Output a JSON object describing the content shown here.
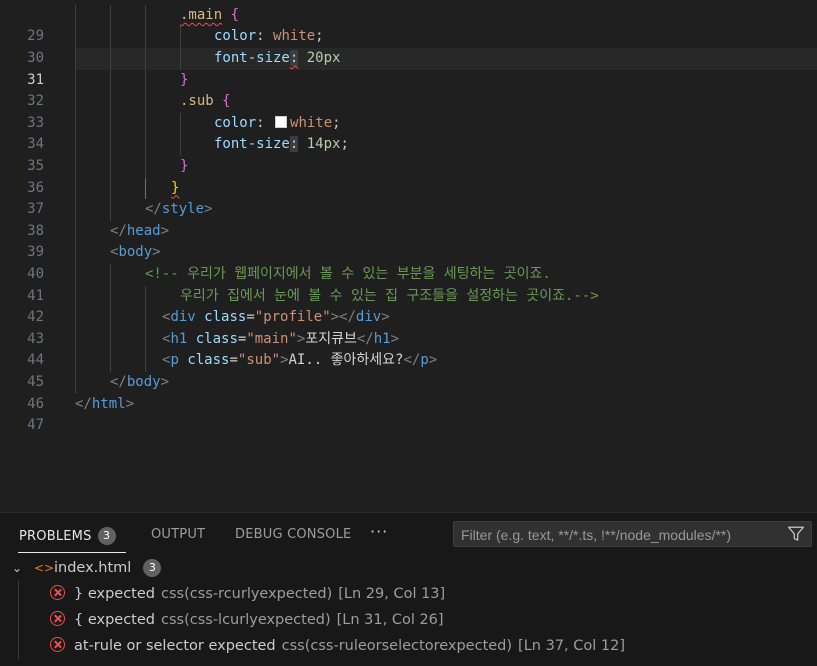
{
  "editor": {
    "current_line": 31,
    "lines": [
      {
        "n": "29"
      },
      {
        "n": "30"
      },
      {
        "n": "31"
      },
      {
        "n": "32"
      },
      {
        "n": "33"
      },
      {
        "n": "34"
      },
      {
        "n": "35"
      },
      {
        "n": "36"
      },
      {
        "n": "37"
      },
      {
        "n": "38"
      },
      {
        "n": "39"
      },
      {
        "n": "40"
      },
      {
        "n": "41"
      },
      {
        "n": "42"
      },
      {
        "n": "43"
      },
      {
        "n": "44"
      },
      {
        "n": "45"
      },
      {
        "n": "46"
      },
      {
        "n": "47"
      }
    ],
    "code": {
      "l29_sel": ".main",
      "l29_brace": "{",
      "l30_prop": "color",
      "l30_val": "white",
      "l31_prop": "font-size",
      "l31_val": "20px",
      "l32_brace": "}",
      "l33_sel": ".sub",
      "l33_brace": "{",
      "l34_prop": "color",
      "l34_val": "white",
      "l35_prop": "font-size",
      "l35_val": "14px",
      "l36_brace": "}",
      "l37_brace": "}",
      "l38_tag": "style",
      "l39_tag": "head",
      "l40_tag": "body",
      "l41_comment": "<!-- 우리가 웹페이지에서 볼 수 있는 부분을 세팅하는 곳이죠.",
      "l42_comment": "우리가 집에서 눈에 볼 수 있는 집 구조들을 설정하는 곳이죠.-->",
      "l43_tag": "div",
      "l43_attr": "class",
      "l43_str": "\"profile\"",
      "l44_tag": "h1",
      "l44_attr": "class",
      "l44_str": "\"main\"",
      "l44_text": "포지큐브",
      "l45_tag": "p",
      "l45_attr": "class",
      "l45_str": "\"sub\"",
      "l45_text": "AI.. 좋아하세요?",
      "l46_tag": "body",
      "l47_tag": "html"
    }
  },
  "panel": {
    "tabs": [
      {
        "label": "PROBLEMS",
        "badge": "3"
      },
      {
        "label": "OUTPUT"
      },
      {
        "label": "DEBUG CONSOLE"
      }
    ],
    "more": "···",
    "filter_placeholder": "Filter (e.g. text, **/*.ts, !**/node_modules/**)",
    "file": {
      "name": "index.html",
      "count": "3"
    },
    "problems": [
      {
        "message": "} expected",
        "source": "css(css-rcurlyexpected)",
        "location": "[Ln 29, Col 13]"
      },
      {
        "message": "{ expected",
        "source": "css(css-lcurlyexpected)",
        "location": "[Ln 31, Col 26]"
      },
      {
        "message": "at-rule or selector expected",
        "source": "css(css-ruleorselectorexpected)",
        "location": "[Ln 37, Col 12]"
      }
    ]
  },
  "colors": {
    "background": "#1f1f1f",
    "error": "#f14c4c",
    "accent": "#e7e7e7"
  }
}
